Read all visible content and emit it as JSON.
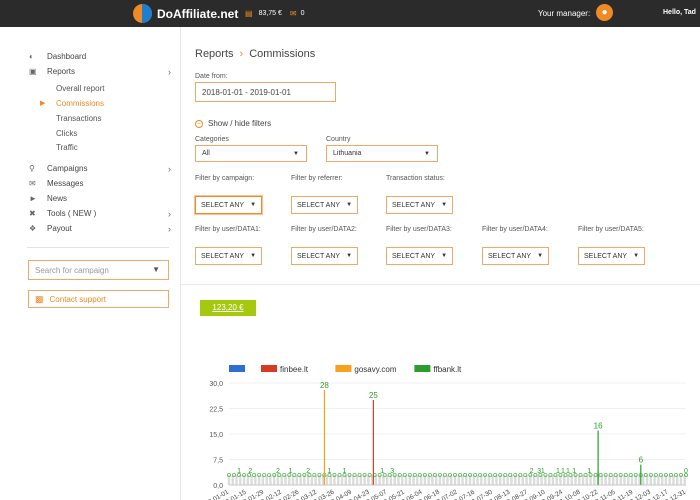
{
  "header": {
    "brand": "DoAffiliate.net",
    "balance": "83,75 €",
    "notifications": "0",
    "manager_label": "Your manager:",
    "greeting": "Hello, Tad"
  },
  "sidebar": {
    "dashboard": "Dashboard",
    "reports": "Reports",
    "reports_sub": [
      "Overall report",
      "Commissions",
      "Transactions",
      "Clicks",
      "Traffic"
    ],
    "campaigns": "Campaigns",
    "messages": "Messages",
    "news": "News",
    "tools": "Tools ( NEW )",
    "payout": "Payout",
    "search_placeholder": "Search for campaign",
    "support": "Contact support"
  },
  "main": {
    "breadcrumb": [
      "Reports",
      "Commissions"
    ],
    "date_label": "Date from:",
    "date_value": "2018-01-01 - 2019-01-01",
    "toggle_filters": "Show / hide filters",
    "categories_label": "Categories",
    "categories_value": "All",
    "country_label": "Country",
    "country_value": "Lithuania",
    "filters_row1": [
      {
        "label": "Filter by campaign:",
        "value": "SELECT ANY"
      },
      {
        "label": "Filter by referrer:",
        "value": "SELECT ANY"
      },
      {
        "label": "Transaction status:",
        "value": "SELECT ANY"
      }
    ],
    "filters_row2": [
      {
        "label": "Filter by user/DATA1:",
        "value": "SELECT ANY"
      },
      {
        "label": "Filter by user/DATA2:",
        "value": "SELECT ANY"
      },
      {
        "label": "Filter by user/DATA3:",
        "value": "SELECT ANY"
      },
      {
        "label": "Filter by user/DATA4:",
        "value": "SELECT ANY"
      },
      {
        "label": "Filter by user/DATA5:",
        "value": "SELECT ANY"
      }
    ],
    "total": "123,20 €"
  },
  "colors": {
    "accent": "#f08a24",
    "brand_blue": "#1e7fd0",
    "total_pill": "#a5c90f"
  },
  "chart_data": {
    "type": "bar",
    "legend_placement": "top",
    "series": [
      {
        "name": "",
        "color": "#2e6fd6"
      },
      {
        "name": "finbee.lt",
        "color": "#d93b22"
      },
      {
        "name": "gosavy.com",
        "color": "#f7a21b"
      },
      {
        "name": "ffbank.lt",
        "color": "#2a9d2a"
      }
    ],
    "ylim": [
      0,
      30
    ],
    "yticks": [
      "30,0",
      "22,5",
      "15,0",
      "7,5",
      "0,0"
    ],
    "xticks": [
      "2018-01-01",
      "2018-01-15",
      "2018-01-29",
      "2018-02-12",
      "2018-02-26",
      "2018-03-12",
      "2018-03-26",
      "2018-04-09",
      "2018-04-23",
      "2018-05-07",
      "2018-05-21",
      "2018-06-04",
      "2018-06-18",
      "2018-07-02",
      "2018-07-16",
      "2018-07-30",
      "2018-08-13",
      "2018-08-27",
      "2018-09-10",
      "2018-09-24",
      "2018-10-08",
      "2018-10-22",
      "2018-11-05",
      "2018-11-19",
      "2018-12-03",
      "2018-12-17",
      "2018-12-31"
    ],
    "spikes": [
      {
        "date": "2018-03-18",
        "value": 28,
        "series": "gosavy.com"
      },
      {
        "date": "2018-04-26",
        "value": 25,
        "series": "finbee.lt"
      },
      {
        "date": "2018-10-22",
        "value": 16,
        "series": "ffbank.lt"
      },
      {
        "date": "2018-11-25",
        "value": 6,
        "series": "ffbank.lt"
      }
    ],
    "data_labels": [
      {
        "date": "2018-01-09",
        "value": 1
      },
      {
        "date": "2018-01-18",
        "value": 2
      },
      {
        "date": "2018-02-09",
        "value": 2
      },
      {
        "date": "2018-02-19",
        "value": 1
      },
      {
        "date": "2018-03-05",
        "value": 2
      },
      {
        "date": "2018-03-22",
        "value": 1
      },
      {
        "date": "2018-04-03",
        "value": 1
      },
      {
        "date": "2018-05-03",
        "value": 1
      },
      {
        "date": "2018-05-11",
        "value": 3
      },
      {
        "date": "2018-08-30",
        "value": 2
      },
      {
        "date": "2018-09-05",
        "value": 3
      },
      {
        "date": "2018-09-08",
        "value": 1
      },
      {
        "date": "2018-09-20",
        "value": 1
      },
      {
        "date": "2018-09-24",
        "value": 1
      },
      {
        "date": "2018-09-28",
        "value": 1
      },
      {
        "date": "2018-10-03",
        "value": 1
      },
      {
        "date": "2018-10-15",
        "value": 1
      },
      {
        "date": "2018-12-31",
        "value": 0
      }
    ]
  }
}
